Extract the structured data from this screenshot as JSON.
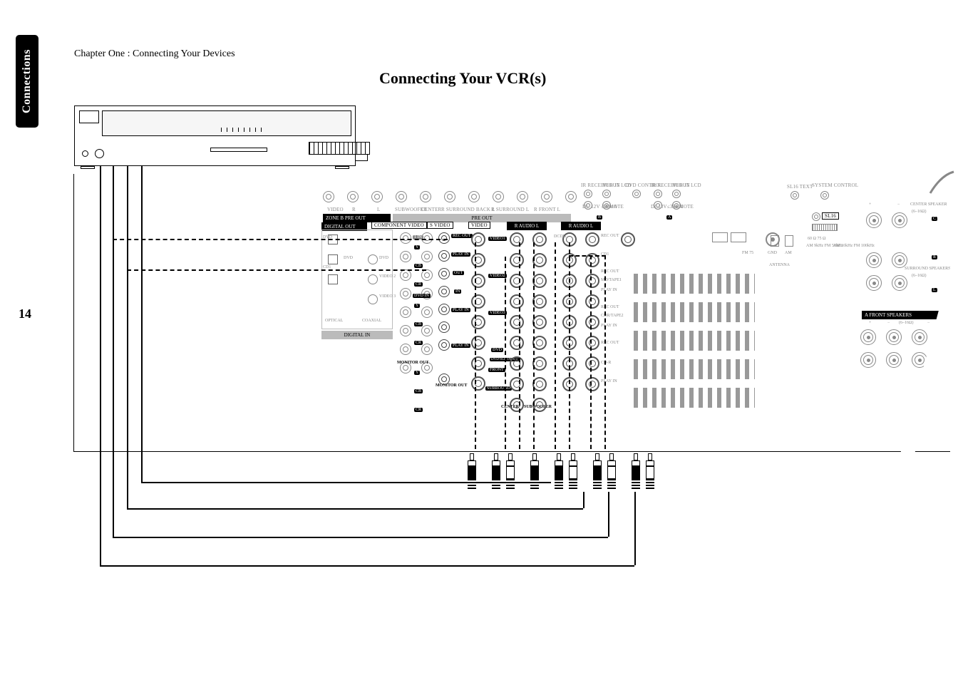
{
  "side_tab": "Connections",
  "chapter": "Chapter One : Connecting Your Devices",
  "title": "Connecting Your VCR(s)",
  "page_number": "14",
  "panel": {
    "top_row": {
      "zone_b_pre_out": "ZONE B PRE OUT",
      "zone_b_cols": [
        "VIDEO",
        "R",
        "L"
      ],
      "pre_out": "PRE OUT",
      "pre_out_cols": [
        "SUBWOOFER",
        "CENTER",
        "R SURROUND BACK L",
        "R SURROUND L",
        "R FRONT L"
      ],
      "ir_receiver_in": "IR RECEIVER IN",
      "ir_out_lcd": "IR OUT LCD",
      "dvd_control": "DVD CONTROL",
      "ir_receiver_in_2": "IR RECEIVER IN",
      "ir_out_lcd_2": "IR OUT LCD",
      "dc12v": "DC 12V ≤20mA",
      "remote": "REMOTE",
      "dc13v": "DC13V≤35mA",
      "remote2": "REMOTE",
      "b_badge": "B",
      "a_badge": "A",
      "sl16_text": "SL16 TEXT",
      "system_control": "SYSTEM CONTROL",
      "sl16": "SL16"
    },
    "sections": {
      "digital_out": "DIGITAL OUT",
      "component_video": "COMPONENT VIDEO",
      "s_video": "S VIDEO",
      "video": "VIDEO",
      "r_audio": "R AUDIO",
      "l_audio": "L",
      "r_audio_l": "R AUDIO L",
      "digital_in": "DIGITAL IN",
      "optical": "OPTICAL",
      "coaxial": "COAXIAL"
    },
    "digital_labels": {
      "dvd": "DVD",
      "cd1": "CD1",
      "video2": "VIDEO 2",
      "video3": "VIDEO 3"
    },
    "component_labels": {
      "y": "Y",
      "cb": "CB",
      "cr": "CR",
      "one_in": "1 IN",
      "dvd_in": "DVD IN",
      "monitor_out": "MONITOR OUT"
    },
    "svideo_labels": {
      "rec_out": "REC OUT",
      "play_in": "PLAY IN",
      "out": "OUT",
      "in": "IN",
      "monitor_out": "MONITOR OUT"
    },
    "row_labels": {
      "video1": "VIDEO1",
      "video2": "VIDEO2",
      "video3": "VIDEO3",
      "dvd": "DVD",
      "dvd_6ch_input": "DVD 6CH INPUT",
      "front": "FRONT",
      "surround": "SURROUND",
      "center": "CENTER",
      "subwoofer": "SUBWOOFER",
      "rec_out": "REC OUT",
      "play_in": "PLAY IN",
      "md_tape1": "MD/TAPE1",
      "cdr_tape2": "CDR/TAPE2",
      "cd_r": "CD-R",
      "cd1": "CD1",
      "dcdi1": "DCDI1"
    },
    "antenna": {
      "label": "ANTENNA",
      "fm75": "FM 75",
      "gnd": "GND",
      "am": "AM",
      "am_band1": "AM 9kHz FM 50kHz",
      "am_band2": "AM 10kHz FM 100kHz",
      "switch_width": "60 Ω   75 Ω"
    },
    "speakers": {
      "center": "CENTER SPEAKER",
      "center_imp": "(6–16Ω)",
      "surround": "SURROUND SPEAKERS",
      "surround_imp": "(6–16Ω)",
      "front_a": "A  FRONT SPEAKERS",
      "front_imp": "(6–16Ω)",
      "plus": "+",
      "minus": "−",
      "r": "R",
      "l": "L",
      "c": "C"
    }
  }
}
